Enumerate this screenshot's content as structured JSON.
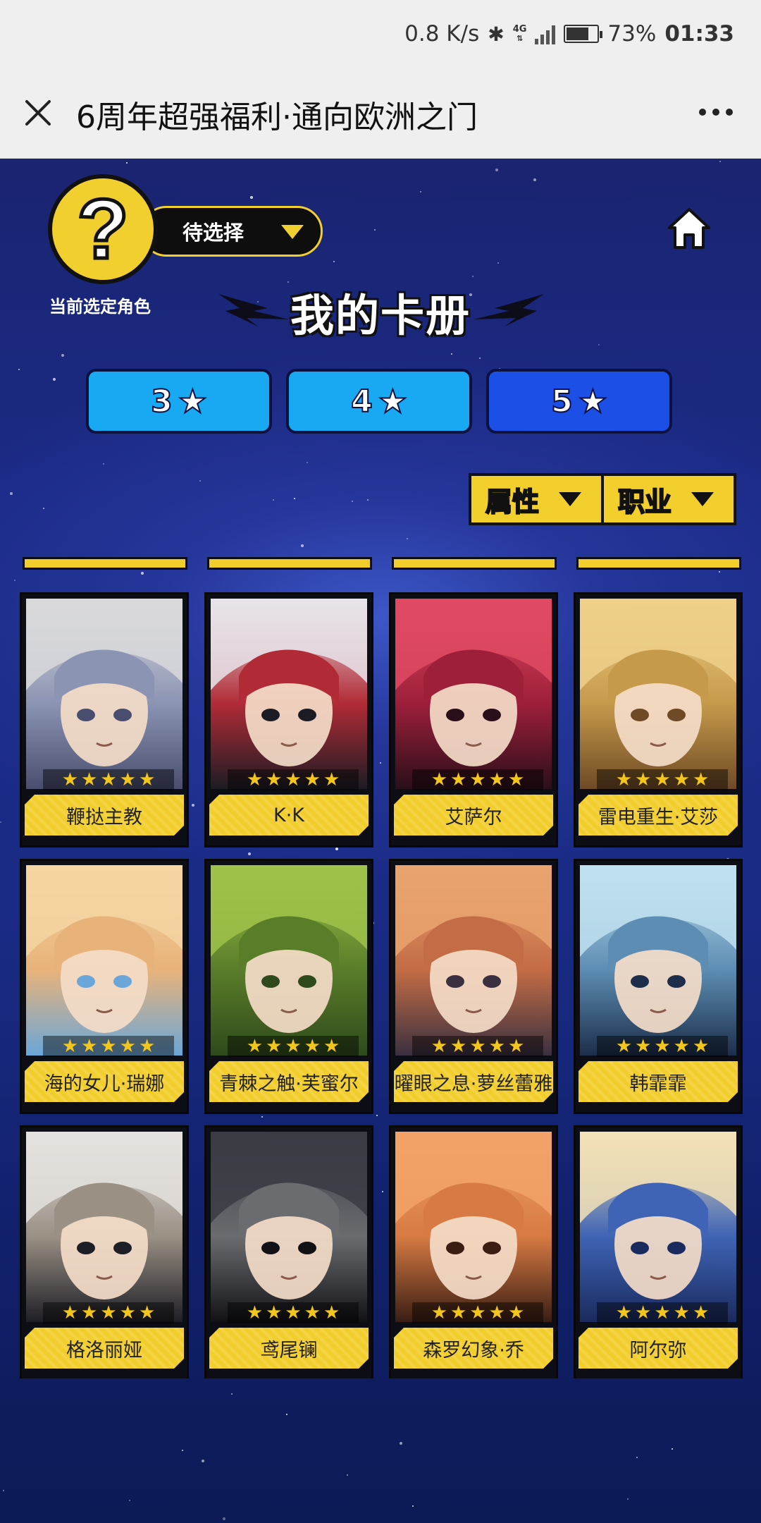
{
  "status_bar": {
    "speed": "0.8 K/s",
    "network": "4G",
    "battery_level_pct": 73,
    "battery": "73%",
    "time": "01:33"
  },
  "title_bar": {
    "title": "6周年超强福利·通向欧洲之门"
  },
  "header": {
    "portrait_glyph": "?",
    "select_label": "待选择",
    "current_role_label": "当前选定角色",
    "album_title": "我的卡册"
  },
  "star_tabs": [
    {
      "label": "3",
      "icon": "★",
      "active": false
    },
    {
      "label": "4",
      "icon": "★",
      "active": false
    },
    {
      "label": "5",
      "icon": "★",
      "active": true
    }
  ],
  "filters": {
    "attribute": "属性",
    "profession": "职业"
  },
  "cards": [
    {
      "name": "鞭挞主教",
      "rarity": 5,
      "palette": [
        "#d9d9dc",
        "#8b94b3",
        "#4a4e6e"
      ]
    },
    {
      "name": "K·K",
      "rarity": 5,
      "palette": [
        "#e8e4ea",
        "#b12b36",
        "#1c1c24"
      ]
    },
    {
      "name": "艾萨尔",
      "rarity": 5,
      "palette": [
        "#e14a63",
        "#9e1f3a",
        "#2a0f1a"
      ]
    },
    {
      "name": "雷电重生·艾莎",
      "rarity": 5,
      "palette": [
        "#efd08a",
        "#c69a4b",
        "#6e4a26"
      ]
    },
    {
      "name": "海的女儿·瑞娜",
      "rarity": 5,
      "palette": [
        "#f4d5a2",
        "#e8b37a",
        "#6aa6d8"
      ]
    },
    {
      "name": "青棘之触·芙蜜尔",
      "rarity": 5,
      "palette": [
        "#9fc24a",
        "#5a7d2a",
        "#2f4a1c"
      ]
    },
    {
      "name": "曜眼之息·萝丝蕾雅",
      "rarity": 5,
      "palette": [
        "#e9a36f",
        "#c46c45",
        "#3a3040"
      ]
    },
    {
      "name": "韩霏霏",
      "rarity": 5,
      "palette": [
        "#bfe1f0",
        "#5d8db3",
        "#1c2e4a"
      ]
    },
    {
      "name": "格洛丽娅",
      "rarity": 5,
      "palette": [
        "#e4e2de",
        "#9a9084",
        "#1e1e26"
      ]
    },
    {
      "name": "鸢尾镧",
      "rarity": 5,
      "palette": [
        "#3b3b44",
        "#6b6c70",
        "#111116"
      ]
    },
    {
      "name": "森罗幻象·乔",
      "rarity": 5,
      "palette": [
        "#f2a26a",
        "#d77a43",
        "#3a1e14"
      ]
    },
    {
      "name": "阿尔弥",
      "rarity": 5,
      "palette": [
        "#f3e2b6",
        "#3f64b5",
        "#1a2a5e"
      ]
    }
  ]
}
